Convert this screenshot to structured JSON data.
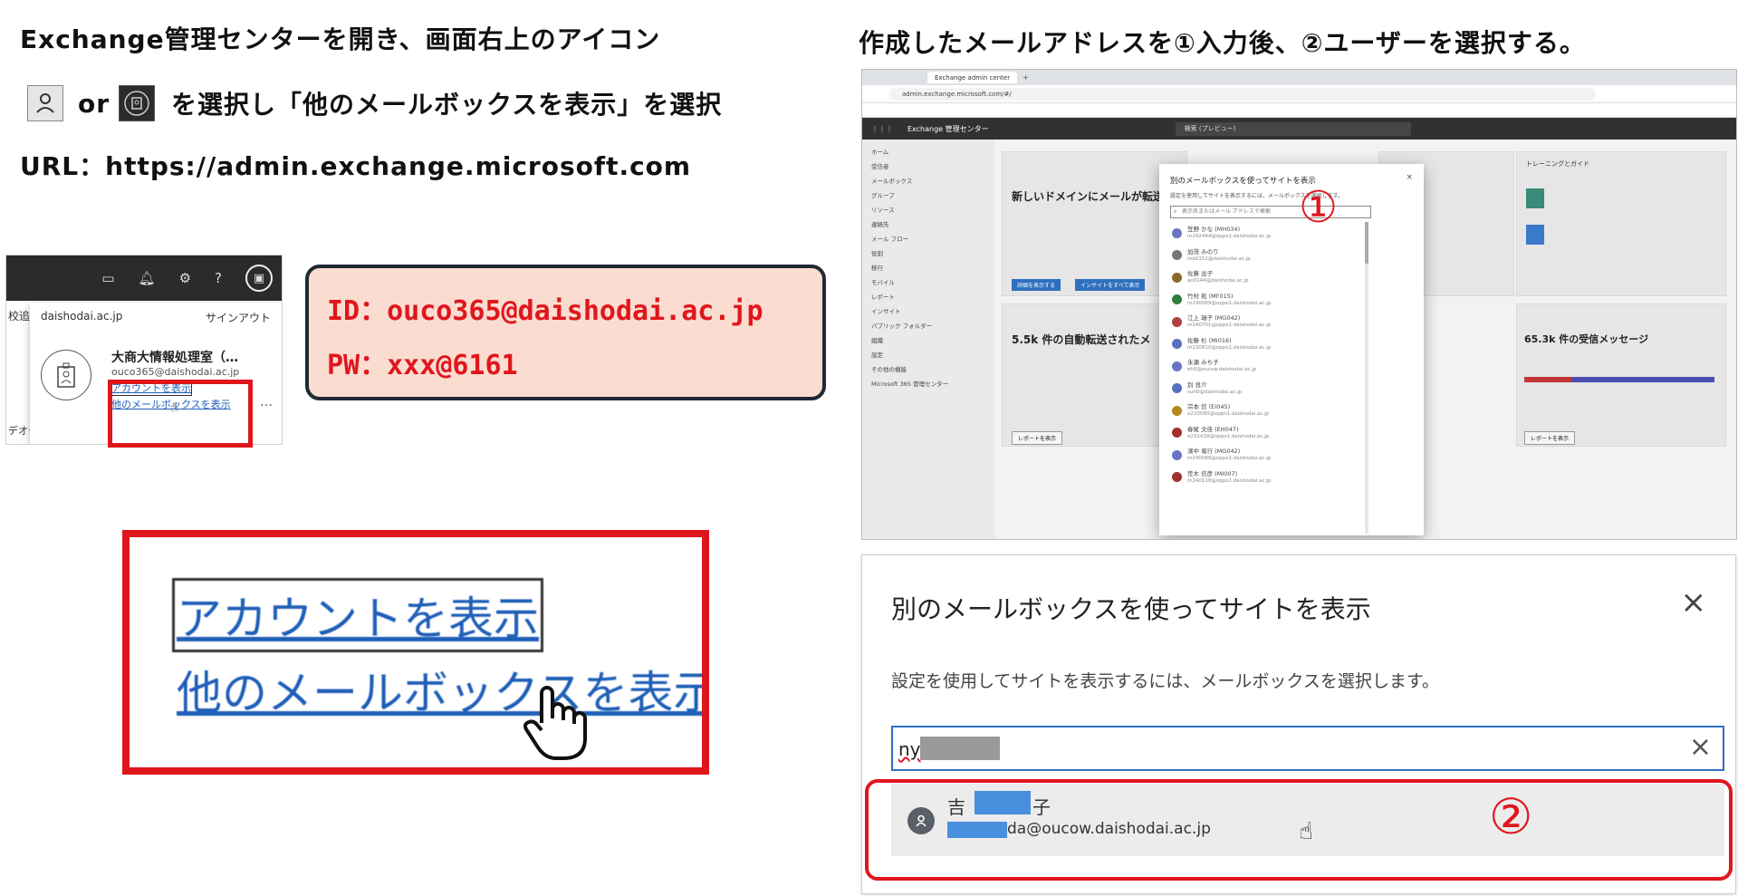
{
  "left": {
    "line1": "Exchange管理センターを開き、画面右上のアイコン",
    "line2_or": "or",
    "line2_rest": "を選択し「他のメールボックスを表示」を選択",
    "line3": "URL：https://admin.exchange.microsoft.com"
  },
  "right_heading": "作成したメールアドレスを①入力後、②ユーザーを選択する。",
  "credentials": {
    "id": "ID：ouco365@daishodai.ac.jp",
    "pw": "PW：xxx@6161"
  },
  "account_panel": {
    "side_text_1": "校追",
    "side_text_2": "デオチ",
    "domain": "daishodai.ac.jp",
    "signout": "サインアウト",
    "name": "大商大情報処理室（…",
    "email": "ouco365@daishodai.ac.jp",
    "link_account": "アカウントを表示",
    "link_other": "他のメールボックスを表示",
    "more": "…",
    "help": "?"
  },
  "zoom": {
    "link_account": "アカウントを表示",
    "link_other": "他のメールボックスを表示"
  },
  "browser": {
    "tab_title": "Exchange admin center",
    "url": "admin.exchange.microsoft.com/#/",
    "app_title": "Exchange 管理センター",
    "search_placeholder": "検索 (プレビュー)",
    "nav_items": [
      "ホーム",
      "受信者",
      "メールボックス",
      "グループ",
      "リソース",
      "連絡先",
      "メール フロー",
      "役割",
      "移行",
      "モバイル",
      "レポート",
      "インサイト",
      "パブリック フォルダー",
      "組織",
      "設定",
      "その他の機能",
      "Microsoft 365 管理センター"
    ],
    "tile_headline": "新しいドメインにメールが転送",
    "tile_headline2": "5.5k 件の自動転送されたメ",
    "tile_right_headline": "65.3k 件の受信メッセージ",
    "tile_left_btn1": "詳細を表示する",
    "tile_left_btn2": "インサイトをすべて表示",
    "report_btn": "レポートを表示",
    "training_title": "トレーニングとガイド",
    "modal_title": "別のメールボックスを使ってサイトを表示",
    "modal_desc": "設定を使用してサイトを表示するには、メールボックスを選択します。",
    "modal_search": "表示名またはメール アドレスで検索",
    "marker": "①",
    "modal_people": [
      {
        "name": "笠野 かな (MH034)",
        "mail": "m242444@oppo1.daishodai.ac.jp",
        "color": "#6b73c4"
      },
      {
        "name": "加茂 みのり",
        "mail": "mb0152@daishodai.ac.jp",
        "color": "#777777"
      },
      {
        "name": "佐藤 出子",
        "mail": "ao0144@daishodai.ac.jp",
        "color": "#8a6a2a"
      },
      {
        "name": "竹村 拓 (MF015)",
        "mail": "m240069@oppo1.daishodai.ac.jp",
        "color": "#2f7f3f"
      },
      {
        "name": "江上 瑞子 (MG042)",
        "mail": "m240701@oppo1.daishodai.ac.jp",
        "color": "#b04040"
      },
      {
        "name": "佐藤 杉 (MI016)",
        "mail": "m230810@oppo1.daishodai.ac.jp",
        "color": "#5a6fbf"
      },
      {
        "name": "永瀬 みち子",
        "mail": "eh0@oucow.daishodai.ac.jp",
        "color": "#6b73c4"
      },
      {
        "name": "別 良介",
        "mail": "sun0@daishodai.ac.jp",
        "color": "#5a6fbf"
      },
      {
        "name": "宗本 信 (EI045)",
        "mail": "e220080@oppo1.daishodai.ac.jp",
        "color": "#b08a20"
      },
      {
        "name": "春尾 文佳 (EH047)",
        "mail": "e231418@oppo1.daishodai.ac.jp",
        "color": "#a03030"
      },
      {
        "name": "濱中 竜行 (MG042)",
        "mail": "m240089@oppo1.daishodai.ac.jp",
        "color": "#6b73c4"
      },
      {
        "name": "荒木 信彦 (MI007)",
        "mail": "m240118@oppo1.daishodai.ac.jp",
        "color": "#a03030"
      }
    ]
  },
  "dialog": {
    "title": "別のメールボックスを使ってサイトを表示",
    "close": "×",
    "desc": "設定を使用してサイトを表示するには、メールボックスを選択します。",
    "input_value": "ny",
    "clear": "×",
    "result_name_a": "吉",
    "result_name_b": "子",
    "result_mail": "da@oucow.daishodai.ac.jp",
    "marker": "②"
  },
  "colors": {
    "red": "#e0161d",
    "link": "#1f5fb8",
    "pink": "#fbdcd0",
    "dark": "#1e2a34"
  }
}
